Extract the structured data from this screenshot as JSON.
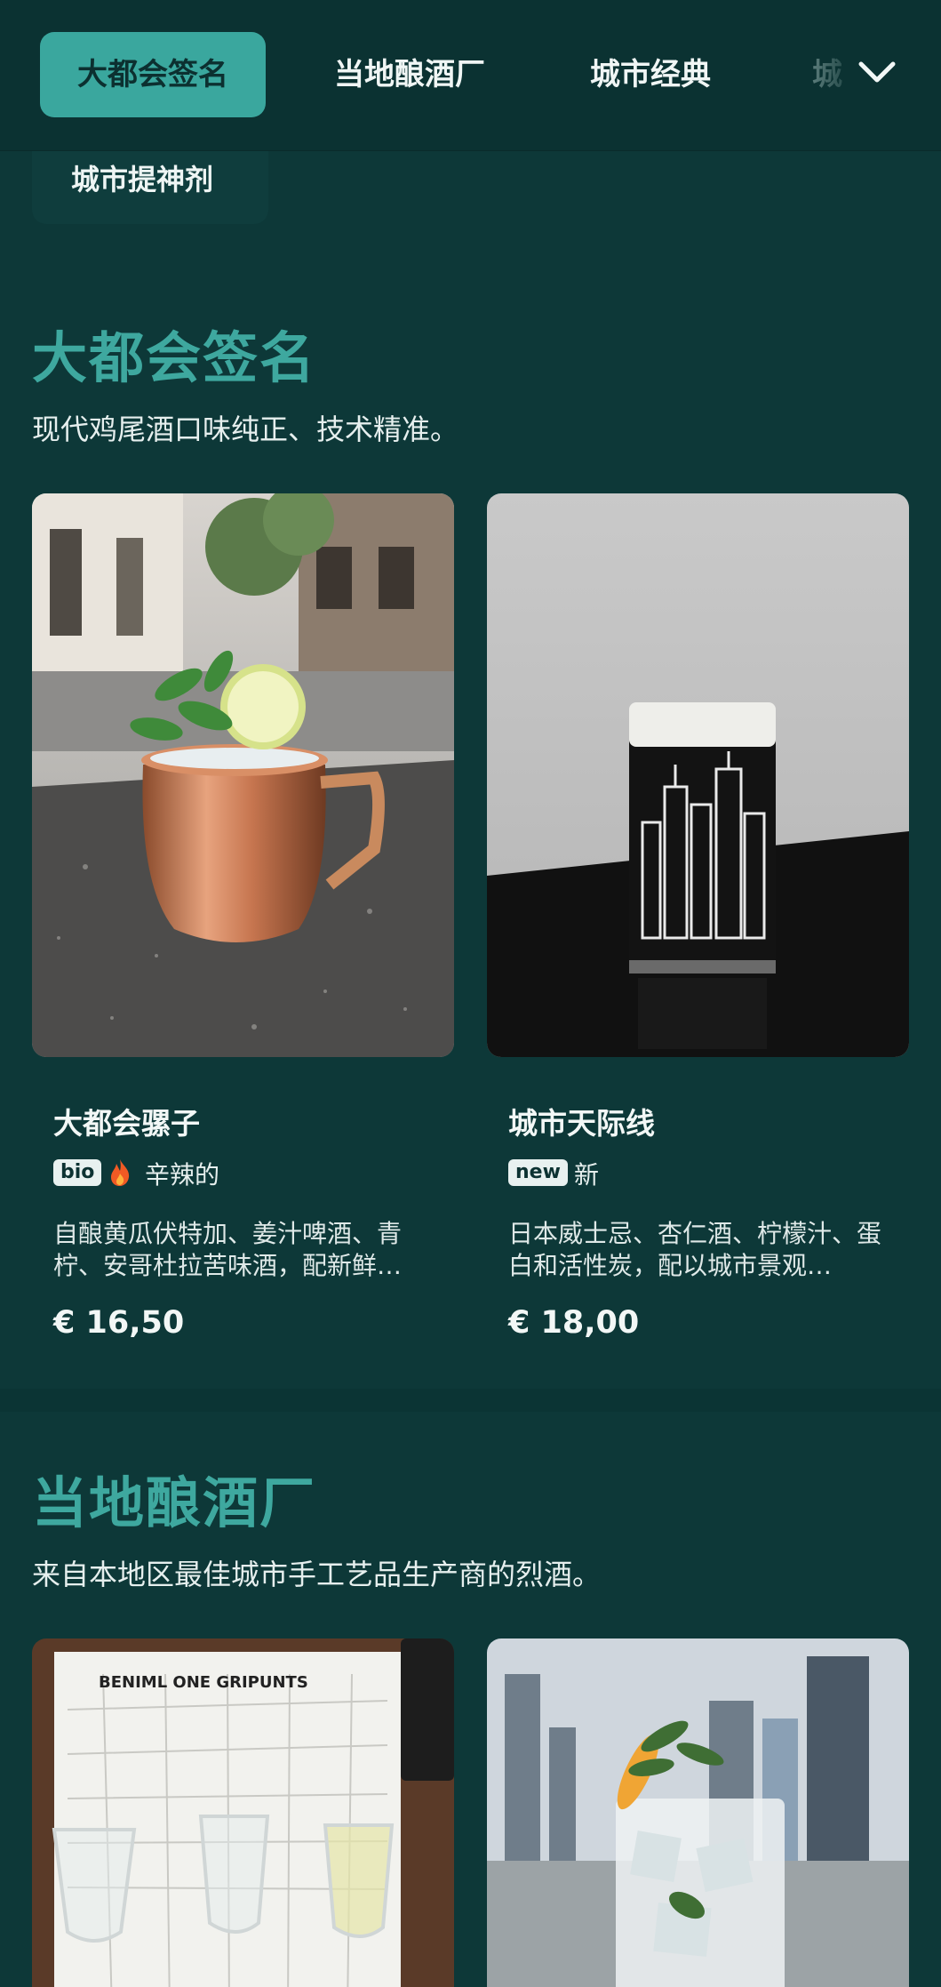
{
  "nav": {
    "tabs": [
      {
        "label": "大都会签名",
        "active": true
      },
      {
        "label": "当地酿酒厂",
        "active": false
      },
      {
        "label": "城市经典",
        "active": false
      },
      {
        "label": "城",
        "active": false
      }
    ],
    "overflow_tab": "城市提神剂",
    "expand_icon": "chevron-down-icon"
  },
  "sections": [
    {
      "title": "大都会签名",
      "subtitle": "现代鸡尾酒口味纯正、技术精准。",
      "items": [
        {
          "name": "大都会骡子",
          "badge": "bio",
          "tag_icon": "flame-icon",
          "tag": "辛辣的",
          "description": "自酿黄瓜伏特加、姜汁啤酒、青柠、安哥杜拉苦味酒，配新鲜…",
          "price": "€ 16,50"
        },
        {
          "name": "城市天际线",
          "badge": "new",
          "tag": "新",
          "description": "日本威士忌、杏仁酒、柠檬汁、蛋白和活性炭，配以城市景观…",
          "price": "€ 18,00"
        }
      ]
    },
    {
      "title": "当地酿酒厂",
      "subtitle": "来自本地区最佳城市手工艺品生产商的烈酒。",
      "items": [
        {
          "name": "",
          "image_text": "BENIML ONE GRIPUNTS"
        },
        {
          "name": ""
        }
      ]
    }
  ],
  "colors": {
    "background": "#0d3838",
    "accent": "#3ea89f",
    "active_tab": "#3aa79e"
  }
}
